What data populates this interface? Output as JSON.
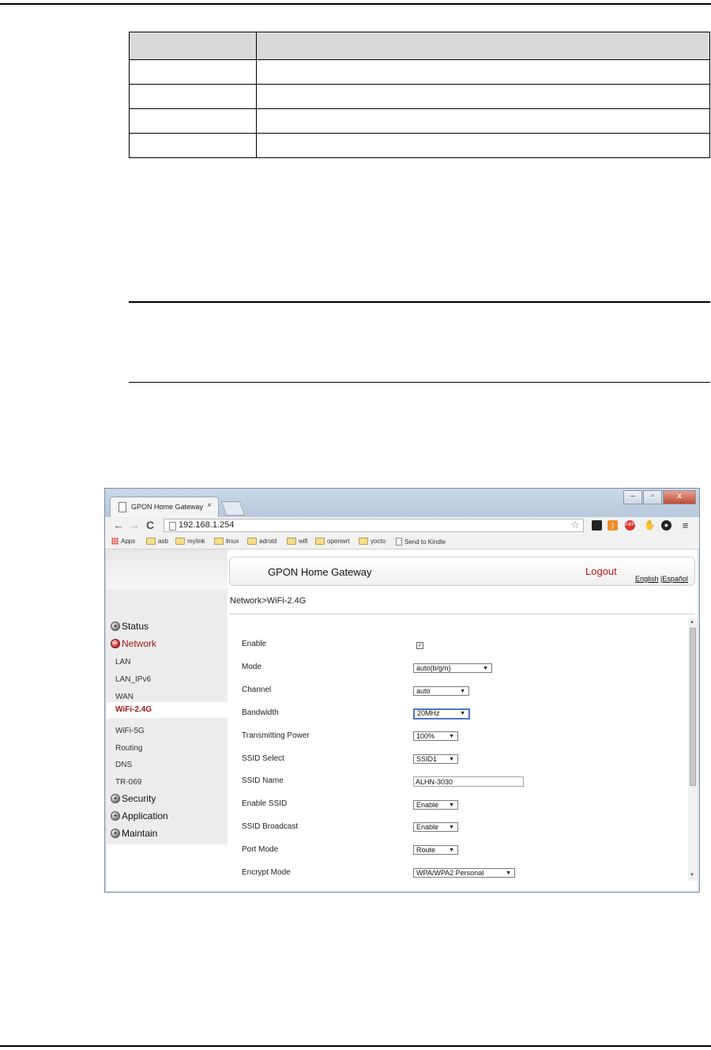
{
  "browser": {
    "tab_title": "GPON Home Gateway",
    "tab_close": "×",
    "url": "192.168.1.254",
    "bookmarks": [
      "Apps",
      "asb",
      "mylink",
      "linux",
      "adroid",
      "wifi",
      "openwrt",
      "yocto",
      "Send to Kindle"
    ],
    "ext_abp": "ABP"
  },
  "gateway": {
    "title": "GPON Home Gateway",
    "logout": "Logout",
    "lang_en": "English",
    "lang_sep": " |",
    "lang_es": "Español",
    "breadcrumb": "Network>WiFi-2.4G"
  },
  "menu": {
    "status": "Status",
    "network": "Network",
    "subitems": [
      "LAN",
      "LAN_IPv6",
      "WAN",
      "WiFi-2.4G",
      "WiFi-5G",
      "Routing",
      "DNS",
      "TR-069"
    ],
    "security": "Security",
    "application": "Application",
    "maintain": "Maintain"
  },
  "form": {
    "enable": {
      "label": "Enable",
      "checked": true
    },
    "mode": {
      "label": "Mode",
      "value": "auto(b/g/n)"
    },
    "channel": {
      "label": "Channel",
      "value": "auto"
    },
    "bandwidth": {
      "label": "Bandwidth",
      "value": "20MHz"
    },
    "tx_power": {
      "label": "Transmitting Power",
      "value": "100%"
    },
    "ssid_select": {
      "label": "SSID Select",
      "value": "SSID1"
    },
    "ssid_name": {
      "label": "SSID Name",
      "value": "ALHN-3030"
    },
    "enable_ssid": {
      "label": "Enable SSID",
      "value": "Enable"
    },
    "ssid_broadcast": {
      "label": "SSID Broadcast",
      "value": "Enable"
    },
    "port_mode": {
      "label": "Port Mode",
      "value": "Route"
    },
    "encrypt_mode": {
      "label": "Encrypt Mode",
      "value": "WPA/WPA2 Personal"
    }
  },
  "colors": {
    "accent_red": "#9a1616",
    "logout_red": "#b01818"
  }
}
